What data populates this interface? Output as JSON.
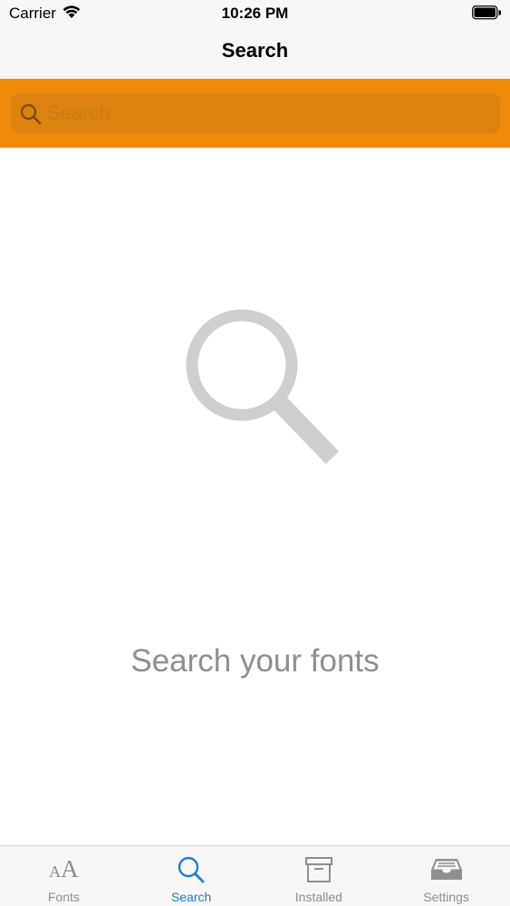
{
  "status_bar": {
    "carrier": "Carrier",
    "time": "10:26 PM",
    "wifi_icon": "wifi-icon",
    "battery_icon": "battery-icon"
  },
  "nav": {
    "title": "Search"
  },
  "search": {
    "placeholder": "Search",
    "value": "",
    "icon": "magnifier-icon",
    "band_color": "#ef8a0a"
  },
  "empty_state": {
    "icon": "magnifier-icon",
    "message": "Search your fonts"
  },
  "tabs": [
    {
      "label": "Fonts",
      "icon": "fonts-aa-icon",
      "active": false,
      "glyph_small": "A",
      "glyph_big": "A"
    },
    {
      "label": "Search",
      "icon": "search-icon",
      "active": true
    },
    {
      "label": "Installed",
      "icon": "archive-box-icon",
      "active": false
    },
    {
      "label": "Settings",
      "icon": "inbox-tray-icon",
      "active": false
    }
  ],
  "colors": {
    "accent": "#1a7fcf",
    "inactive": "#8e8e93",
    "orange": "#ef8a0a"
  }
}
